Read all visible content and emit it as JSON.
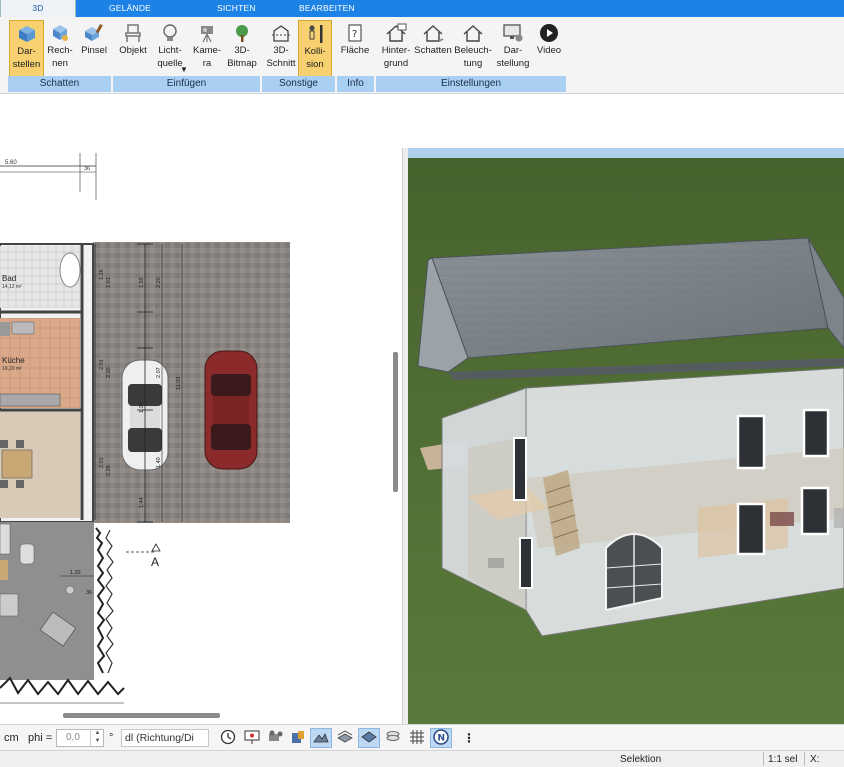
{
  "tabs": {
    "t3d": "3D",
    "gelaende": "GELÄNDE",
    "sichten": "SICHTEN",
    "bearbeiten": "BEARBEITEN"
  },
  "ribbon": {
    "darstellen": "Dar-\nstellen",
    "rechnen": "Rech-\nnen",
    "pinsel": "Pinsel",
    "objekt": "Objekt",
    "lichtquelle": "Licht-\nquelle",
    "kamera": "Kame-\nra",
    "bitmap": "3D-\nBitmap",
    "schnitt": "3D-\nSchnitt",
    "kollision": "Kolli-\nsion",
    "flaeche": "Fläche",
    "hintergrund": "Hinter-\ngrund",
    "schatten": "Schatten",
    "beleuchtung": "Beleuch-\ntung",
    "darstellung": "Dar-\nstellung",
    "video": "Video"
  },
  "groups": {
    "schatten": "Schatten",
    "einfuegen": "Einfügen",
    "sonstige": "Sonstige",
    "info": "Info",
    "einstellungen": "Einstellungen"
  },
  "plan": {
    "dim_top": "5.60",
    "dim_top_small": "36",
    "room_bad": "Bad",
    "room_bad_area": "14,12 m²",
    "room_kueche": "Küche",
    "room_kueche_area": "19,20 m²",
    "marker": "A",
    "dims": {
      "d1": "1.26",
      "d2": "1.01",
      "d3": "2.01",
      "d4": "2.26",
      "d5": "2.01",
      "d6": "2.26",
      "d7": "1.32",
      "d8": "36",
      "d9": "1.59",
      "d10": "2.20",
      "d11": "11.03",
      "d12": "1.24",
      "d13": "1.44",
      "d14": "1.40",
      "d15": "2.07"
    }
  },
  "bottom": {
    "unit": "cm",
    "phi_label": "phi =",
    "phi_value": "0,0",
    "degree": "°",
    "direction": "dl (Richtung/Di"
  },
  "status": {
    "mode": "Selektion",
    "scale": "1:1 sel",
    "coord": "X:"
  },
  "colors": {
    "tabbar": "#1d82e6",
    "group_bar": "#a9cff2",
    "active_button": "#f7d070",
    "grass": "#4f6b34",
    "sky": "#9fc8e8"
  }
}
